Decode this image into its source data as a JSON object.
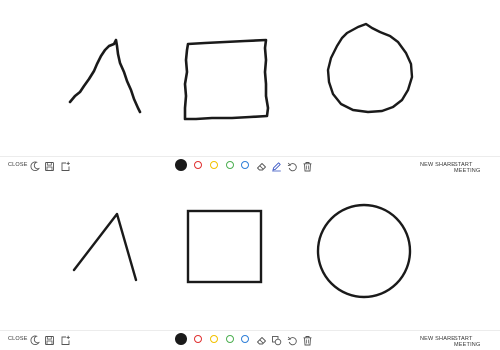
{
  "toolbar": {
    "close_label": "CLOSE",
    "new_share_label": "NEW SHARE",
    "start_meeting_label": "START MEETING"
  },
  "colors": {
    "ink": "#1a1a1a",
    "swatches": [
      {
        "name": "black",
        "hex": "#1a1a1a",
        "selected": true
      },
      {
        "name": "red",
        "hex": "#e03131",
        "selected": false
      },
      {
        "name": "yellow",
        "hex": "#f2c200",
        "selected": false
      },
      {
        "name": "green",
        "hex": "#4caf50",
        "selected": false
      },
      {
        "name": "blue",
        "hex": "#2f7fd8",
        "selected": false
      }
    ]
  },
  "panels": [
    {
      "name": "freehand-drawing",
      "shapes": [
        "triangle-stroke",
        "square",
        "circle"
      ],
      "tools": [
        "eraser-icon",
        "pen-icon",
        "undo-icon",
        "trash-icon"
      ]
    },
    {
      "name": "shape-recognized-drawing",
      "shapes": [
        "triangle-stroke",
        "square",
        "circle"
      ],
      "tools": [
        "eraser-icon",
        "shapes-icon",
        "undo-icon",
        "trash-icon"
      ]
    }
  ]
}
